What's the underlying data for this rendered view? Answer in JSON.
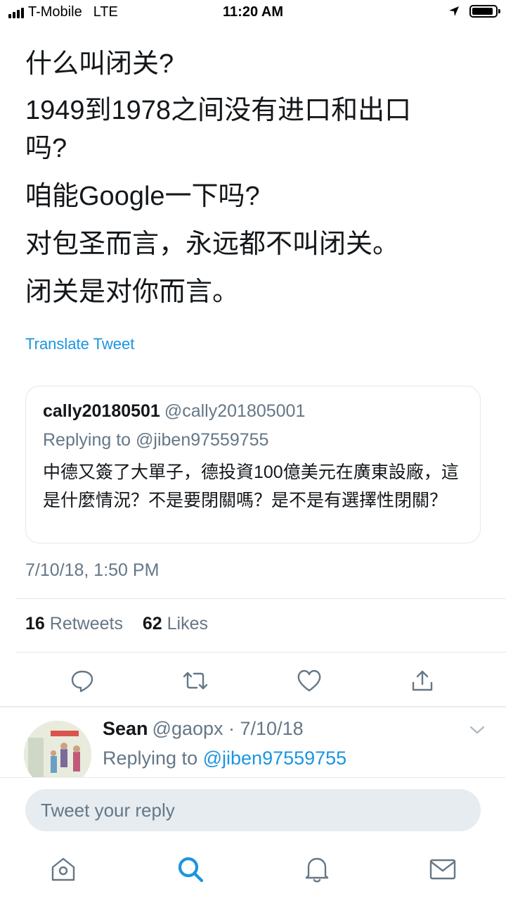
{
  "status_bar": {
    "carrier": "T-Mobile",
    "network": "LTE",
    "time": "11:20 AM",
    "battery_level": 0.9
  },
  "tweet": {
    "lines": [
      "什么叫闭关?",
      "1949到1978之间没有进口和出口吗?",
      "咱能Google一下吗?",
      "对包圣而言，永远都不叫闭关。",
      "闭关是对你而言。"
    ],
    "translate_label": "Translate Tweet",
    "quoted": {
      "name": "cally20180501",
      "handle": "@cally201805001",
      "replying_to": "Replying to @jiben97559755",
      "text": "中德又簽了大單子，德投資100億美元在廣東設廠，這是什麼情況？不是要閉關嗎？是不是有選擇性閉關？"
    },
    "timestamp": "7/10/18, 1:50 PM",
    "retweets_count": "16",
    "retweets_label": "Retweets",
    "likes_count": "62",
    "likes_label": "Likes"
  },
  "icons": {
    "reply": "reply-icon",
    "retweet": "retweet-icon",
    "like": "like-icon",
    "share": "share-icon"
  },
  "reply": {
    "name": "Sean",
    "meta": "@gaopx · 7/10/18",
    "replying_prefix": "Replying to",
    "replying_mention": "@jiben97559755"
  },
  "compose": {
    "placeholder": "Tweet your reply"
  },
  "colors": {
    "link_blue": "#1b95e0",
    "secondary_text": "#657786",
    "primary_text": "#14171a",
    "divider": "#e1e8ed"
  }
}
